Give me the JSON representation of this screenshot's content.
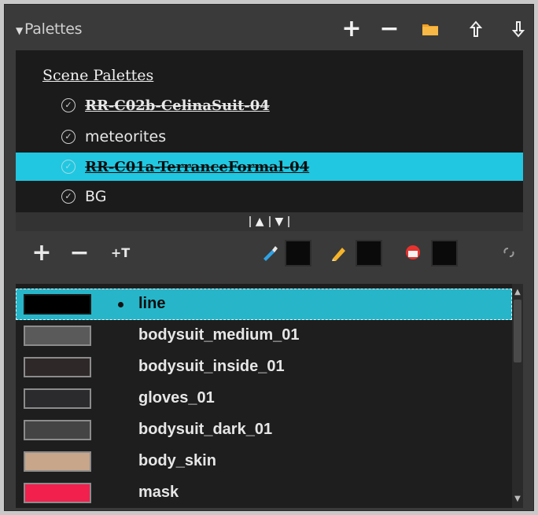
{
  "panel": {
    "title": "Palettes",
    "collapse_glyph": "▼"
  },
  "header_buttons": [
    {
      "name": "add-palette-button",
      "glyph": "+"
    },
    {
      "name": "remove-palette-button",
      "glyph": "−"
    },
    {
      "name": "import-palette-button",
      "icon": "folder-icon"
    },
    {
      "name": "move-palette-up-button",
      "glyph": "↑"
    },
    {
      "name": "move-palette-down-button",
      "glyph": "↓"
    }
  ],
  "tree": {
    "category": "Scene Palettes",
    "items": [
      {
        "label": "RR-C02b-CelinaSuit-04",
        "style": "struck",
        "selected": false
      },
      {
        "label": "meteorites",
        "style": "normal",
        "selected": false
      },
      {
        "label": "RR-C01a-TerranceFormal-04",
        "style": "struck",
        "selected": true
      },
      {
        "label": "BG",
        "style": "normal",
        "selected": false
      }
    ]
  },
  "toolbar": {
    "add_glyph": "+",
    "remove_glyph": "−",
    "texture_glyph": "+T",
    "tools": [
      "brush-icon",
      "pencil-icon",
      "paint-bucket-icon"
    ],
    "link_icon": "link-icon"
  },
  "colors": [
    {
      "name": "line",
      "color": "#000000",
      "selected": true
    },
    {
      "name": "bodysuit_medium_01",
      "color": "#5a5a5a",
      "selected": false
    },
    {
      "name": "bodysuit_inside_01",
      "color": "#2e2829",
      "selected": false
    },
    {
      "name": "gloves_01",
      "color": "#2b2a2d",
      "selected": false
    },
    {
      "name": "bodysuit_dark_01",
      "color": "#444444",
      "selected": false
    },
    {
      "name": "body_skin",
      "color": "#c8a68a",
      "selected": false
    },
    {
      "name": "mask",
      "color": "#f2204d",
      "selected": false
    }
  ],
  "theme": {
    "selection": "#21c7e0",
    "list_selection": "#27b6c9"
  }
}
